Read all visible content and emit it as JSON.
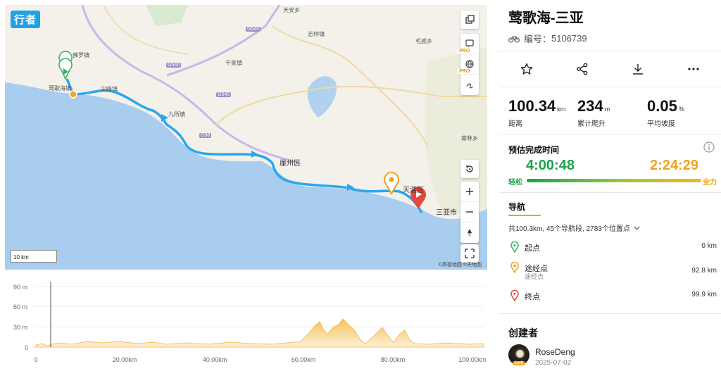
{
  "map": {
    "app_badge": "行者",
    "labels": {
      "yinggehai_town": "莺歌海镇",
      "foluo": "佛罗镇",
      "jianfeng": "尖峰镇",
      "qianjia": "千家镇",
      "zhizhong": "志仲镇",
      "maogan": "毛感乡",
      "jiusuo": "九所镇",
      "yazhou": "崖州区",
      "tianya": "天涯区",
      "sanya": "三亚市",
      "nanlin": "南林乡",
      "tianan": "天安乡"
    },
    "road_shields": [
      "G540",
      "G540",
      "G540",
      "G98"
    ],
    "pro_tag": "PRO",
    "scale_label": "10 km",
    "credit": "©高德地图 ©天地图"
  },
  "elevation": {
    "y_labels": [
      "90 m",
      "60 m",
      "30 m",
      "0"
    ],
    "x_labels": [
      "0",
      "20.00km",
      "40.00km",
      "60.00km",
      "80.00km",
      "100.00km"
    ]
  },
  "route": {
    "title": "莺歌海-三亚",
    "id_label": "编号：",
    "id_value": "5106739"
  },
  "stats": [
    {
      "value": "100.34",
      "unit": "km",
      "label": "距离"
    },
    {
      "value": "234",
      "unit": "m",
      "label": "累计爬升"
    },
    {
      "value": "0.05",
      "unit": "%",
      "label": "平均坡度"
    }
  ],
  "estimate": {
    "title": "预估完成时间",
    "relaxed_time": "4:00:48",
    "full_time": "2:24:29",
    "relaxed_label": "轻松",
    "full_label": "全力"
  },
  "nav": {
    "title": "导航",
    "summary": "共100.3km, 45个导航段, 2783个位置点",
    "waypoints": [
      {
        "name": "起点",
        "sub": "",
        "dist": "0 km",
        "color": "#2db55d"
      },
      {
        "name": "途经点",
        "sub": "途经点",
        "dist": "92.8 km",
        "color": "#f0a21b"
      },
      {
        "name": "终点",
        "sub": "",
        "dist": "99.9 km",
        "color": "#e6473a"
      }
    ]
  },
  "creator": {
    "heading": "创建者",
    "name": "RoseDeng",
    "date": "2025-07-02",
    "level": "Lv.6"
  },
  "colors": {
    "route": "#2aa7f0",
    "sea": "#a8cdef",
    "accent": "#f0a21b"
  }
}
